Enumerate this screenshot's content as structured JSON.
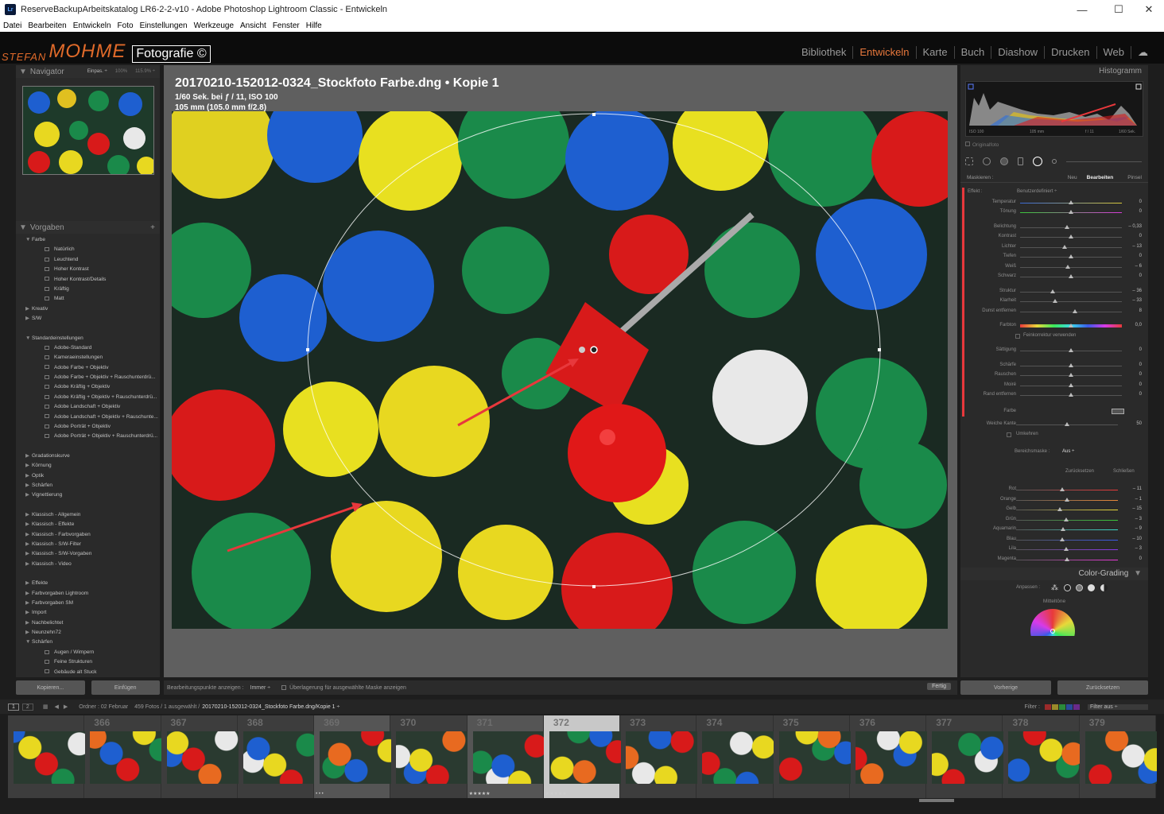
{
  "window": {
    "title": "ReserveBackupArbeitskatalog LR6-2-2-v10 - Adobe Photoshop Lightroom Classic - Entwickeln",
    "app_icon": "Lr",
    "minimize": "—",
    "maximize": "☐",
    "close": "✕"
  },
  "menu": [
    "Datei",
    "Bearbeiten",
    "Entwickeln",
    "Foto",
    "Einstellungen",
    "Werkzeuge",
    "Ansicht",
    "Fenster",
    "Hilfe"
  ],
  "identity": {
    "name_small": "STEFAN",
    "name_large": "MOHME",
    "badge": "Fotografie ©"
  },
  "modules": {
    "items": [
      "Bibliothek",
      "Entwickeln",
      "Karte",
      "Buch",
      "Diashow",
      "Drucken",
      "Web"
    ],
    "active": "Entwickeln"
  },
  "navigator": {
    "title": "Navigator",
    "zoom_options": [
      "Einpas. ÷",
      "100%",
      "115.9% ÷"
    ]
  },
  "presets": {
    "title": "Vorgaben",
    "add": "+",
    "rows": [
      {
        "t": "folder",
        "label": "Farbe",
        "open": true
      },
      {
        "t": "sub",
        "label": "Natürlich"
      },
      {
        "t": "sub",
        "label": "Leuchtend"
      },
      {
        "t": "sub",
        "label": "Hoher Kontrast"
      },
      {
        "t": "sub",
        "label": "Hoher Kontrast/Details"
      },
      {
        "t": "sub",
        "label": "Kräftig"
      },
      {
        "t": "sub",
        "label": "Matt"
      },
      {
        "t": "folder",
        "label": "Kreativ"
      },
      {
        "t": "folder",
        "label": "S/W"
      },
      {
        "t": "gap"
      },
      {
        "t": "folder",
        "label": "Standardeinstellungen",
        "open": true
      },
      {
        "t": "sub",
        "label": "Adobe-Standard"
      },
      {
        "t": "sub",
        "label": "Kameraeinstellungen"
      },
      {
        "t": "sub",
        "label": "Adobe Farbe + Objektiv"
      },
      {
        "t": "sub",
        "label": "Adobe Farbe + Objektiv + Rauschunterdrü..."
      },
      {
        "t": "sub",
        "label": "Adobe Kräftig + Objektiv"
      },
      {
        "t": "sub",
        "label": "Adobe Kräftig + Objektiv + Rauschunterdrü..."
      },
      {
        "t": "sub",
        "label": "Adobe Landschaft + Objektiv"
      },
      {
        "t": "sub",
        "label": "Adobe Landschaft + Objektiv + Rauschunte..."
      },
      {
        "t": "sub",
        "label": "Adobe Porträt + Objektiv"
      },
      {
        "t": "sub",
        "label": "Adobe Porträt + Objektiv + Rauschunterdrü..."
      },
      {
        "t": "gap"
      },
      {
        "t": "folder",
        "label": "Gradationskurve"
      },
      {
        "t": "folder",
        "label": "Körnung"
      },
      {
        "t": "folder",
        "label": "Optik"
      },
      {
        "t": "folder",
        "label": "Schärfen"
      },
      {
        "t": "folder",
        "label": "Vignettierung"
      },
      {
        "t": "gap"
      },
      {
        "t": "folder",
        "label": "Klassisch - Allgemein"
      },
      {
        "t": "folder",
        "label": "Klassisch - Effekte"
      },
      {
        "t": "folder",
        "label": "Klassisch - Farbvorgaben"
      },
      {
        "t": "folder",
        "label": "Klassisch - S/W-Filter"
      },
      {
        "t": "folder",
        "label": "Klassisch - S/W-Vorgaben"
      },
      {
        "t": "folder",
        "label": "Klassisch - Video"
      },
      {
        "t": "gap"
      },
      {
        "t": "folder",
        "label": "Effekte"
      },
      {
        "t": "folder",
        "label": "Farbvorgaben Lightroom"
      },
      {
        "t": "folder",
        "label": "Farbvorgaben SM"
      },
      {
        "t": "folder",
        "label": "Import"
      },
      {
        "t": "folder",
        "label": "Nachbelichtet"
      },
      {
        "t": "folder",
        "label": "Neunzehn72"
      },
      {
        "t": "folder",
        "label": "Schärfen",
        "open": true
      },
      {
        "t": "sub",
        "label": "Augen / Wimpern"
      },
      {
        "t": "sub",
        "label": "Feine Strukturen"
      },
      {
        "t": "sub",
        "label": "Gebäude alt Stuck"
      }
    ]
  },
  "left_buttons": {
    "copy": "Kopieren...",
    "paste": "Einfügen"
  },
  "photo_info": {
    "filename": "20170210-152012-0324_Stockfoto Farbe.dng  •  Kopie 1",
    "exposure": "1/60 Sek. bei ƒ / 11, ISO 100",
    "lens": "105 mm (105.0 mm f/2.8)"
  },
  "toolbar": {
    "show_points": "Bearbeitungspunkte anzeigen :",
    "show_points_value": "Immer ÷",
    "overlay": "Überlagerung für ausgewählte Maske anzeigen",
    "done": "Fertig"
  },
  "histogram": {
    "title": "Histogramm",
    "iso": "ISO 100",
    "focal": "105 mm",
    "aperture": "f / 11",
    "shutter": "1/60 Sek.",
    "original": "Originalfoto"
  },
  "mask": {
    "label": "Maskieren :",
    "new": "Neu",
    "edit": "Bearbeiten",
    "brush": "Pinsel"
  },
  "effect": {
    "label": "Effekt :",
    "value": "Benutzerdefiniert ÷"
  },
  "sliders": [
    {
      "label": "Temperatur",
      "value": "0",
      "pos": 0.5,
      "g": 1
    },
    {
      "label": "Tönung",
      "value": "0",
      "pos": 0.5,
      "g": 1
    },
    {
      "label": "Belichtung",
      "value": "– 0,33",
      "pos": 0.46,
      "g": 2
    },
    {
      "label": "Kontrast",
      "value": "0",
      "pos": 0.5,
      "g": 2
    },
    {
      "label": "Lichter",
      "value": "– 13",
      "pos": 0.44,
      "g": 2
    },
    {
      "label": "Tiefen",
      "value": "0",
      "pos": 0.5,
      "g": 2
    },
    {
      "label": "Weiß",
      "value": "– 6",
      "pos": 0.47,
      "g": 2
    },
    {
      "label": "Schwarz",
      "value": "0",
      "pos": 0.5,
      "g": 2
    },
    {
      "label": "Struktur",
      "value": "– 36",
      "pos": 0.32,
      "g": 3
    },
    {
      "label": "Klarheit",
      "value": "– 33",
      "pos": 0.34,
      "g": 3
    },
    {
      "label": "Dunst entfernen",
      "value": "8",
      "pos": 0.54,
      "g": 3
    },
    {
      "label": "Farbton",
      "value": "0,0",
      "pos": 0.5,
      "g": 4
    },
    {
      "label": "Sättigung",
      "value": "0",
      "pos": 0.5,
      "g": 5
    },
    {
      "label": "Schärfe",
      "value": "0",
      "pos": 0.5,
      "g": 6
    },
    {
      "label": "Rauschen",
      "value": "0",
      "pos": 0.5,
      "g": 6
    },
    {
      "label": "Moiré",
      "value": "0",
      "pos": 0.5,
      "g": 6
    },
    {
      "label": "Rand entfernen",
      "value": "0",
      "pos": 0.5,
      "g": 6
    }
  ],
  "fine_correction": "Feinkorrektur verwenden",
  "color_label": "Farbe",
  "feather": {
    "label": "Weiche Kante",
    "value": "50",
    "pos": 0.5
  },
  "invert": "Umkehren",
  "range_mask": {
    "label": "Bereichsmaske :",
    "value": "Aus ÷"
  },
  "mask_buttons": {
    "reset": "Zurücksetzen",
    "close": "Schließen"
  },
  "hsl": [
    {
      "label": "Rot",
      "value": "– 11",
      "pos": 0.45
    },
    {
      "label": "Orange",
      "value": "– 1",
      "pos": 0.5
    },
    {
      "label": "Gelb",
      "value": "– 15",
      "pos": 0.43
    },
    {
      "label": "Grün",
      "value": "– 3",
      "pos": 0.49
    },
    {
      "label": "Aquamarin",
      "value": "– 9",
      "pos": 0.46
    },
    {
      "label": "Blau",
      "value": "– 10",
      "pos": 0.45
    },
    {
      "label": "Lila",
      "value": "– 3",
      "pos": 0.49
    },
    {
      "label": "Magenta",
      "value": "0",
      "pos": 0.5
    }
  ],
  "color_grading": {
    "title": "Color-Grading",
    "adjust": "Anpassen :",
    "midtones": "Mitteltöne"
  },
  "right_buttons": {
    "previous": "Vorherige",
    "reset": "Zurücksetzen"
  },
  "filmstrip_bar": {
    "page1": "1",
    "page2": "2",
    "source": "Ordner : 02 Februar",
    "count": "459 Fotos / 1 ausgewählt /",
    "path": "20170210-152012-0324_Stockfoto Farbe.dng/Kopie 1 ÷",
    "filter_label": "Filter :",
    "filter_value": "Filter aus ÷"
  },
  "filmstrip": [
    {
      "num": "",
      "stars": "",
      "state": ""
    },
    {
      "num": "366",
      "stars": "",
      "state": ""
    },
    {
      "num": "367",
      "stars": "",
      "state": ""
    },
    {
      "num": "368",
      "stars": "",
      "state": ""
    },
    {
      "num": "369",
      "stars": "• • •",
      "state": "sel"
    },
    {
      "num": "370",
      "stars": "",
      "state": ""
    },
    {
      "num": "371",
      "stars": "★★★★★",
      "state": "sel"
    },
    {
      "num": "372",
      "stars": "★★★★★",
      "state": "active"
    },
    {
      "num": "373",
      "stars": "",
      "state": ""
    },
    {
      "num": "374",
      "stars": "",
      "state": ""
    },
    {
      "num": "375",
      "stars": "",
      "state": ""
    },
    {
      "num": "376",
      "stars": "",
      "state": ""
    },
    {
      "num": "377",
      "stars": "",
      "state": ""
    },
    {
      "num": "378",
      "stars": "",
      "state": ""
    },
    {
      "num": "379",
      "stars": "",
      "state": ""
    }
  ],
  "colors": {
    "accent": "#e8783c",
    "annotation": "#e8383c",
    "panel": "#2a2a2a"
  }
}
